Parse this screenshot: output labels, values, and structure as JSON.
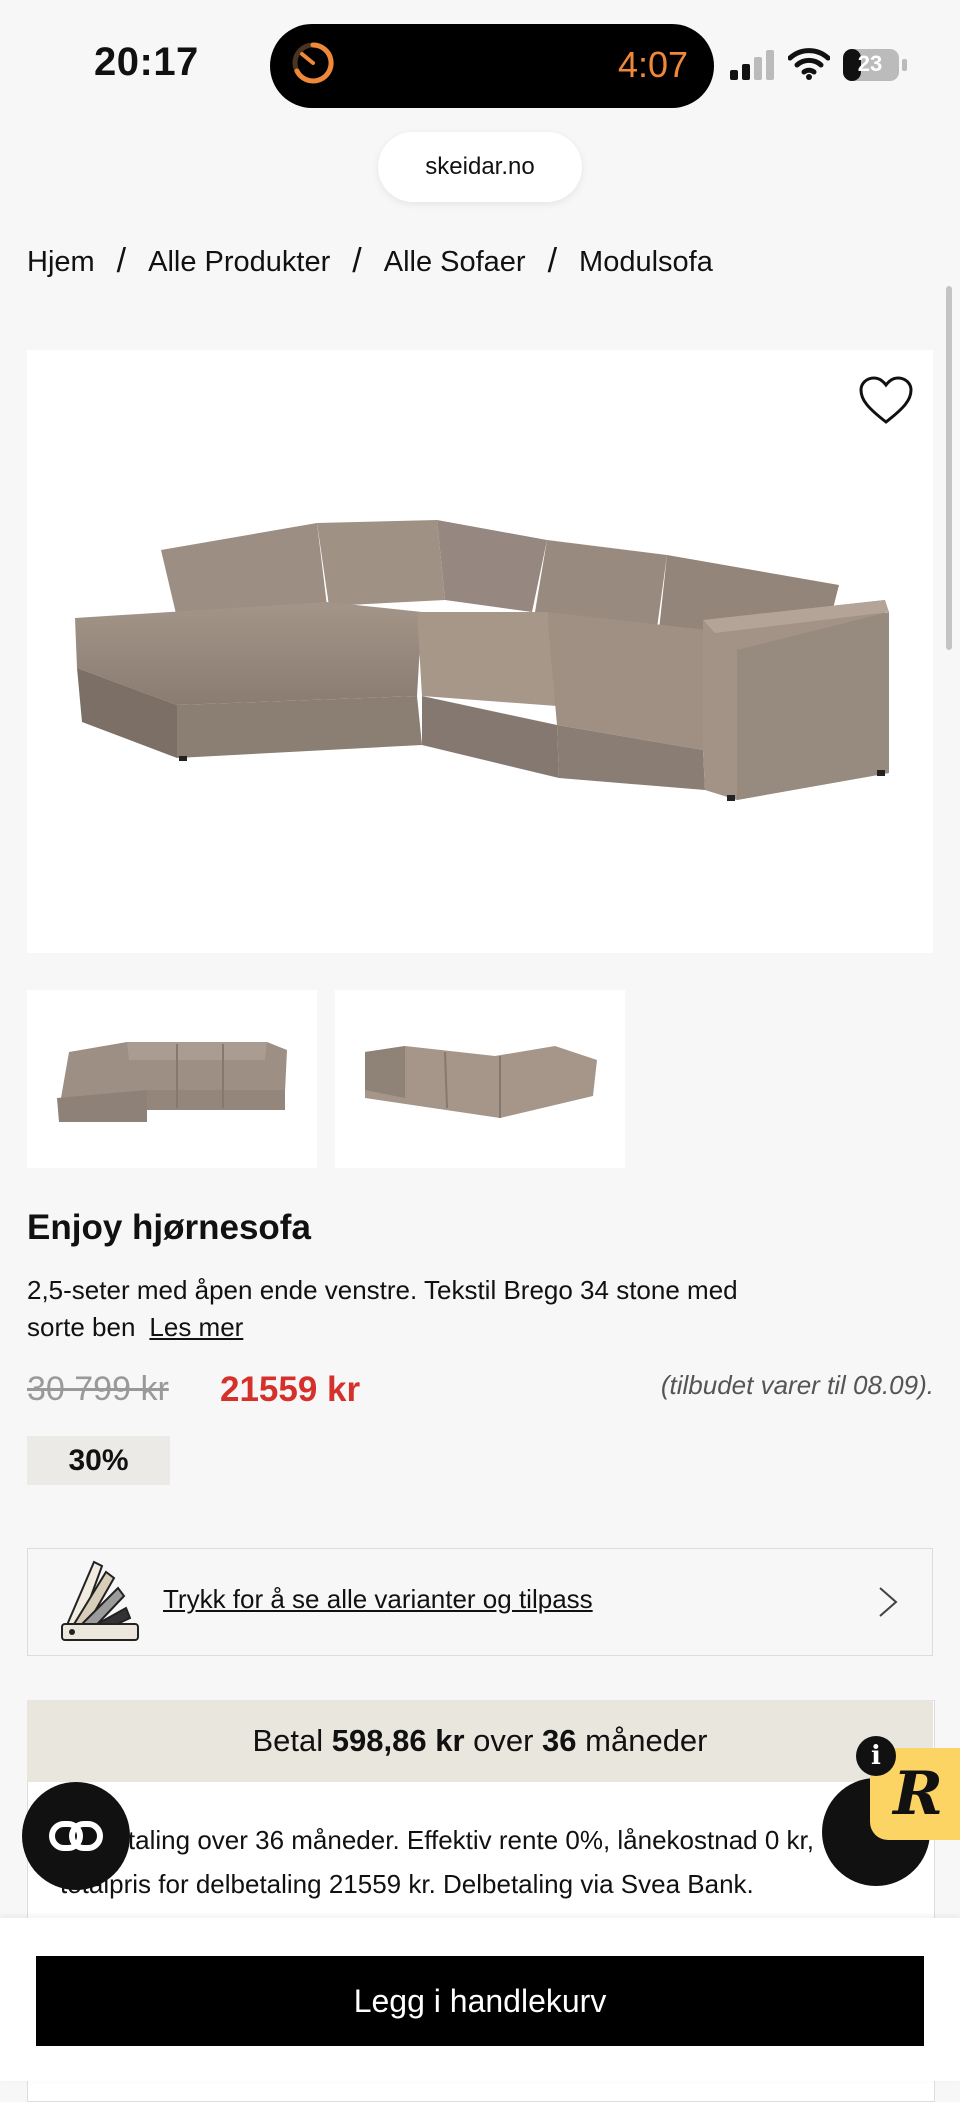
{
  "status_bar": {
    "time": "20:17",
    "timer": "4:07",
    "battery": "23"
  },
  "browser": {
    "url": "skeidar.no"
  },
  "breadcrumb": [
    "Hjem",
    "Alle Produkter",
    "Alle Sofaer",
    "Modulsofa"
  ],
  "product": {
    "title": "Enjoy hjørnesofa",
    "description": "2,5-seter med åpen ende venstre. Tekstil Brego 34 stone med sorte ben",
    "read_more": "Les mer",
    "old_price": "30 799 kr",
    "new_price": "21559 kr",
    "offer_note": "(tilbudet varer til 08.09).",
    "discount": "30%"
  },
  "variants": {
    "label": "Trykk for å se alle varianter og tilpass"
  },
  "payment": {
    "head_prefix": "Betal ",
    "amount": "598,86 kr",
    "head_mid": " over ",
    "months": "36",
    "head_suffix": " måneder",
    "text": "Delbetaling over 36 måneder. Effektiv rente 0%, lånekostnad 0 kr, totalpris for delbetaling 21559 kr. Delbetaling via Svea Bank."
  },
  "floating": {
    "r_badge": "R",
    "info_badge": "i"
  },
  "cta": {
    "add_to_cart": "Legg i handlekurv"
  },
  "colors": {
    "accent_price": "#d6302a",
    "timer": "#f0883a",
    "payment_header": "#e9e6dd",
    "r_badge": "#fbd463"
  }
}
